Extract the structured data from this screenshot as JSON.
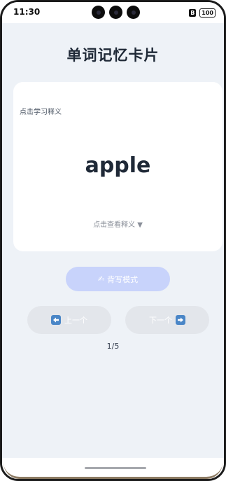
{
  "status_bar": {
    "time": "11:30",
    "sim_label": "B",
    "battery": "100"
  },
  "page": {
    "title": "单词记忆卡片"
  },
  "card": {
    "hint": "点击学习释义",
    "word": "apple",
    "reveal": "点击查看释义 ▼"
  },
  "actions": {
    "dictation_icon": "✍",
    "dictation_label": "背写模式",
    "prev_label": "上一个",
    "next_label": "下一个"
  },
  "progress": {
    "counter": "1/5"
  },
  "colors": {
    "accent_light": "#c8d3fb",
    "nav_button": "#e3e6eb",
    "arrow_icon": "#4a86c7",
    "background": "#eef2f7"
  },
  "icons": {
    "prev": "left-arrow-icon",
    "next": "right-arrow-icon",
    "dictation": "writing-hand-icon"
  }
}
